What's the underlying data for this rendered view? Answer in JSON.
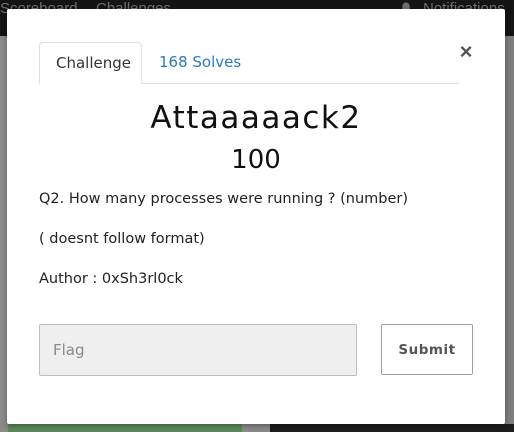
{
  "background_nav": {
    "scoreboard_label": "Scoreboard",
    "challenges_label": "Challenges",
    "notifications_label": "Notifications",
    "bell_icon": "bell-icon"
  },
  "modal": {
    "close_label": "×",
    "tabs": [
      {
        "label": "Challenge",
        "active": true
      },
      {
        "label": "168 Solves",
        "active": false
      }
    ],
    "challenge": {
      "name": "Attaaaaack2",
      "value": "100",
      "description": [
        "Q2. How many processes were running ? (number)",
        "( doesnt follow format)",
        "Author : 0xSh3rl0ck"
      ]
    },
    "flag_input": {
      "value": "",
      "placeholder": "Flag"
    },
    "submit_label": "Submit"
  },
  "colors": {
    "link": "#2c7bbf",
    "nav_bg": "#141414",
    "backdrop": "#8b8b8b",
    "green_card": "#5d8a5a"
  }
}
